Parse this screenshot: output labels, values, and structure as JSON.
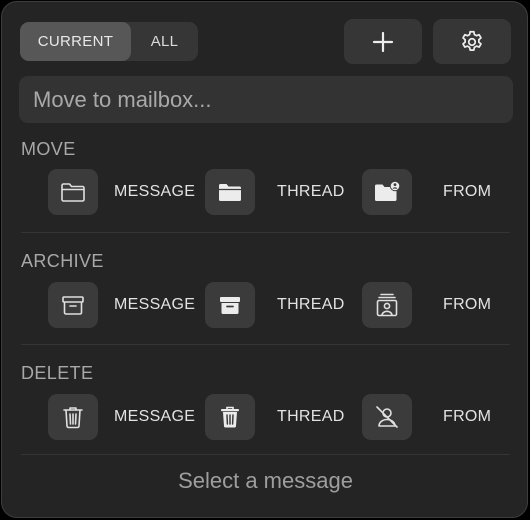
{
  "tabs": {
    "current_label": "CURRENT",
    "all_label": "ALL",
    "selected": "current"
  },
  "toolbar": {
    "add_icon": "plus-icon",
    "settings_icon": "gear-icon"
  },
  "search": {
    "placeholder": "Move to mailbox..."
  },
  "sections": {
    "move": {
      "title": "MOVE",
      "message_label": "MESSAGE",
      "thread_label": "THREAD",
      "from_label": "FROM",
      "icons": [
        "folder-outline-icon",
        "folder-filled-icon",
        "folder-person-icon"
      ]
    },
    "archive": {
      "title": "ARCHIVE",
      "message_label": "MESSAGE",
      "thread_label": "THREAD",
      "from_label": "FROM",
      "icons": [
        "archive-box-outline-icon",
        "archive-box-filled-icon",
        "archive-person-icon"
      ]
    },
    "delete": {
      "title": "DELETE",
      "message_label": "MESSAGE",
      "thread_label": "THREAD",
      "from_label": "FROM",
      "icons": [
        "trash-outline-icon",
        "trash-filled-icon",
        "person-slash-icon"
      ]
    }
  },
  "status": {
    "text": "Select a message"
  },
  "colors": {
    "panel_bg": "#242424",
    "button_bg": "#3b3b3b",
    "segment_selected": "#575757",
    "text": "#e2e2e2",
    "muted_text": "#a8a8a8"
  }
}
